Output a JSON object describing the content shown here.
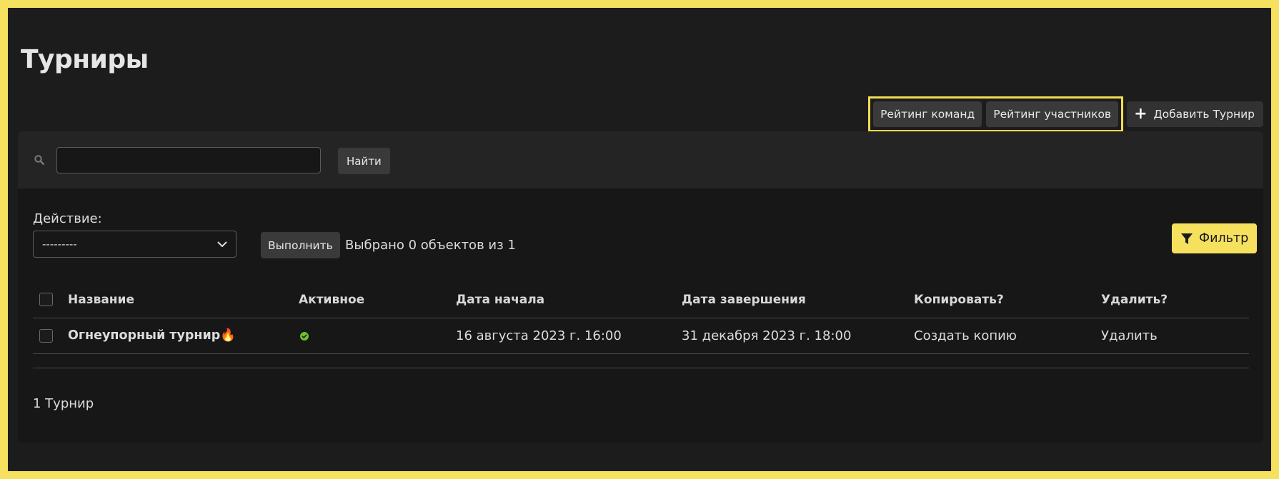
{
  "page": {
    "title": "Турниры"
  },
  "header_buttons": {
    "team_rating": "Рейтинг команд",
    "participant_rating": "Рейтинг участников",
    "add_tournament": "Добавить Турнир"
  },
  "search": {
    "value": "",
    "placeholder": "",
    "button": "Найти"
  },
  "actions": {
    "label": "Действие:",
    "selected": "---------",
    "run_button": "Выполнить",
    "selection_status": "Выбрано 0 объектов из 1"
  },
  "filter": {
    "label": "Фильтр"
  },
  "table": {
    "headers": [
      "Название",
      "Активное",
      "Дата начала",
      "Дата завершения",
      "Копировать?",
      "Удалить?"
    ],
    "rows": [
      {
        "name": "Огнеупорный турнир🔥",
        "active": true,
        "start": "16 августа 2023 г. 16:00",
        "end": "31 декабря 2023 г. 18:00",
        "copy": "Создать копию",
        "delete": "Удалить"
      }
    ]
  },
  "footer": {
    "count": "1 Турнир"
  },
  "colors": {
    "accent": "#f5e15e",
    "background": "#1c1c1c",
    "arrow": "#e0345a",
    "active_icon": "#6fc32c"
  }
}
